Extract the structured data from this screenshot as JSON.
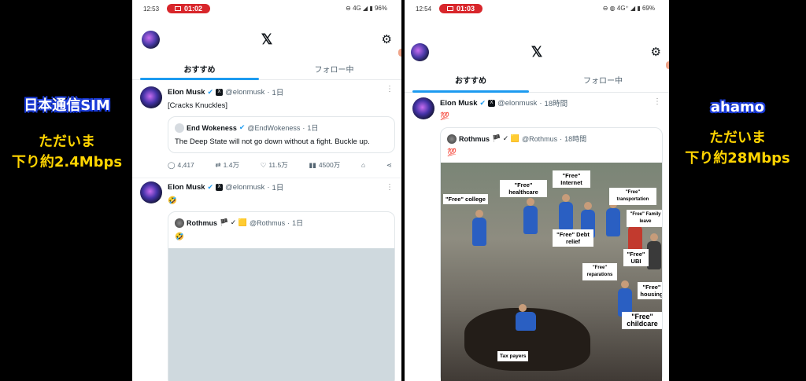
{
  "captions": {
    "left": {
      "title": "日本通信SIM",
      "line1": "ただいま",
      "line2": "下り約2.4Mbps"
    },
    "right": {
      "title": "ahamo",
      "line1": "ただいま",
      "line2": "下り約28Mbps"
    }
  },
  "left_phone": {
    "status": {
      "time": "12:53",
      "rec": "01:02",
      "right": "⊖ 4G ◢ ▮ 96%"
    },
    "tabs": [
      "おすすめ",
      "フォロー中"
    ],
    "tweets": [
      {
        "name": "Elon Musk",
        "handle": "@elonmusk",
        "time": "1日",
        "text": "[Cracks Knuckles]",
        "quote": {
          "name": "End Wokeness",
          "handle": "@EndWokeness",
          "time": "1日",
          "text": "The Deep State will not go down without a fight. Buckle up."
        },
        "actions": {
          "replies": "4,417",
          "retweets": "1.4万",
          "likes": "11.5万",
          "views": "4500万"
        }
      },
      {
        "name": "Elon Musk",
        "handle": "@elonmusk",
        "time": "1日",
        "text": "🤣",
        "quote": {
          "name": "Rothmus",
          "flags": "🏴 ✓ 🟨",
          "handle": "@Rothmus",
          "time": "1日",
          "text": "🤣"
        }
      }
    ]
  },
  "right_phone": {
    "status": {
      "time": "12:54",
      "rec": "01:03",
      "right": "⊖ ◍ 4G⁺ ◢ ▮ 69%"
    },
    "tabs": [
      "おすすめ",
      "フォロー中"
    ],
    "tweet": {
      "name": "Elon Musk",
      "handle": "@elonmusk",
      "time": "18時間",
      "text": "💯",
      "quote": {
        "name": "Rothmus",
        "flags": "🏴 ✓ 🟨",
        "handle": "@Rothmus",
        "time": "18時間",
        "text": "💯"
      },
      "meme_labels": {
        "college": "\"Free\" college",
        "healthcare": "\"Free\" healthcare",
        "internet": "\"Free\" Internet",
        "transportation": "\"Free\" transportation",
        "family_leave": "\"Free\" Family leave",
        "debt_relief": "\"Free\" Debt relief",
        "ubi": "\"Free\" UBI",
        "reparations": "\"Free\" reparations",
        "housing": "\"Free\" housing",
        "childcare": "\"Free\" childcare",
        "tax_payers": "Tax payers"
      }
    }
  },
  "icons": {
    "logo": "x-logo-icon",
    "settings": "gear-icon",
    "more": "more-icon",
    "verified": "verified-icon"
  },
  "colors": {
    "accent": "#1d9bf0",
    "rec": "#d8262b",
    "caption_yellow": "#ffd400",
    "caption_outline": "#1a3bd8"
  }
}
